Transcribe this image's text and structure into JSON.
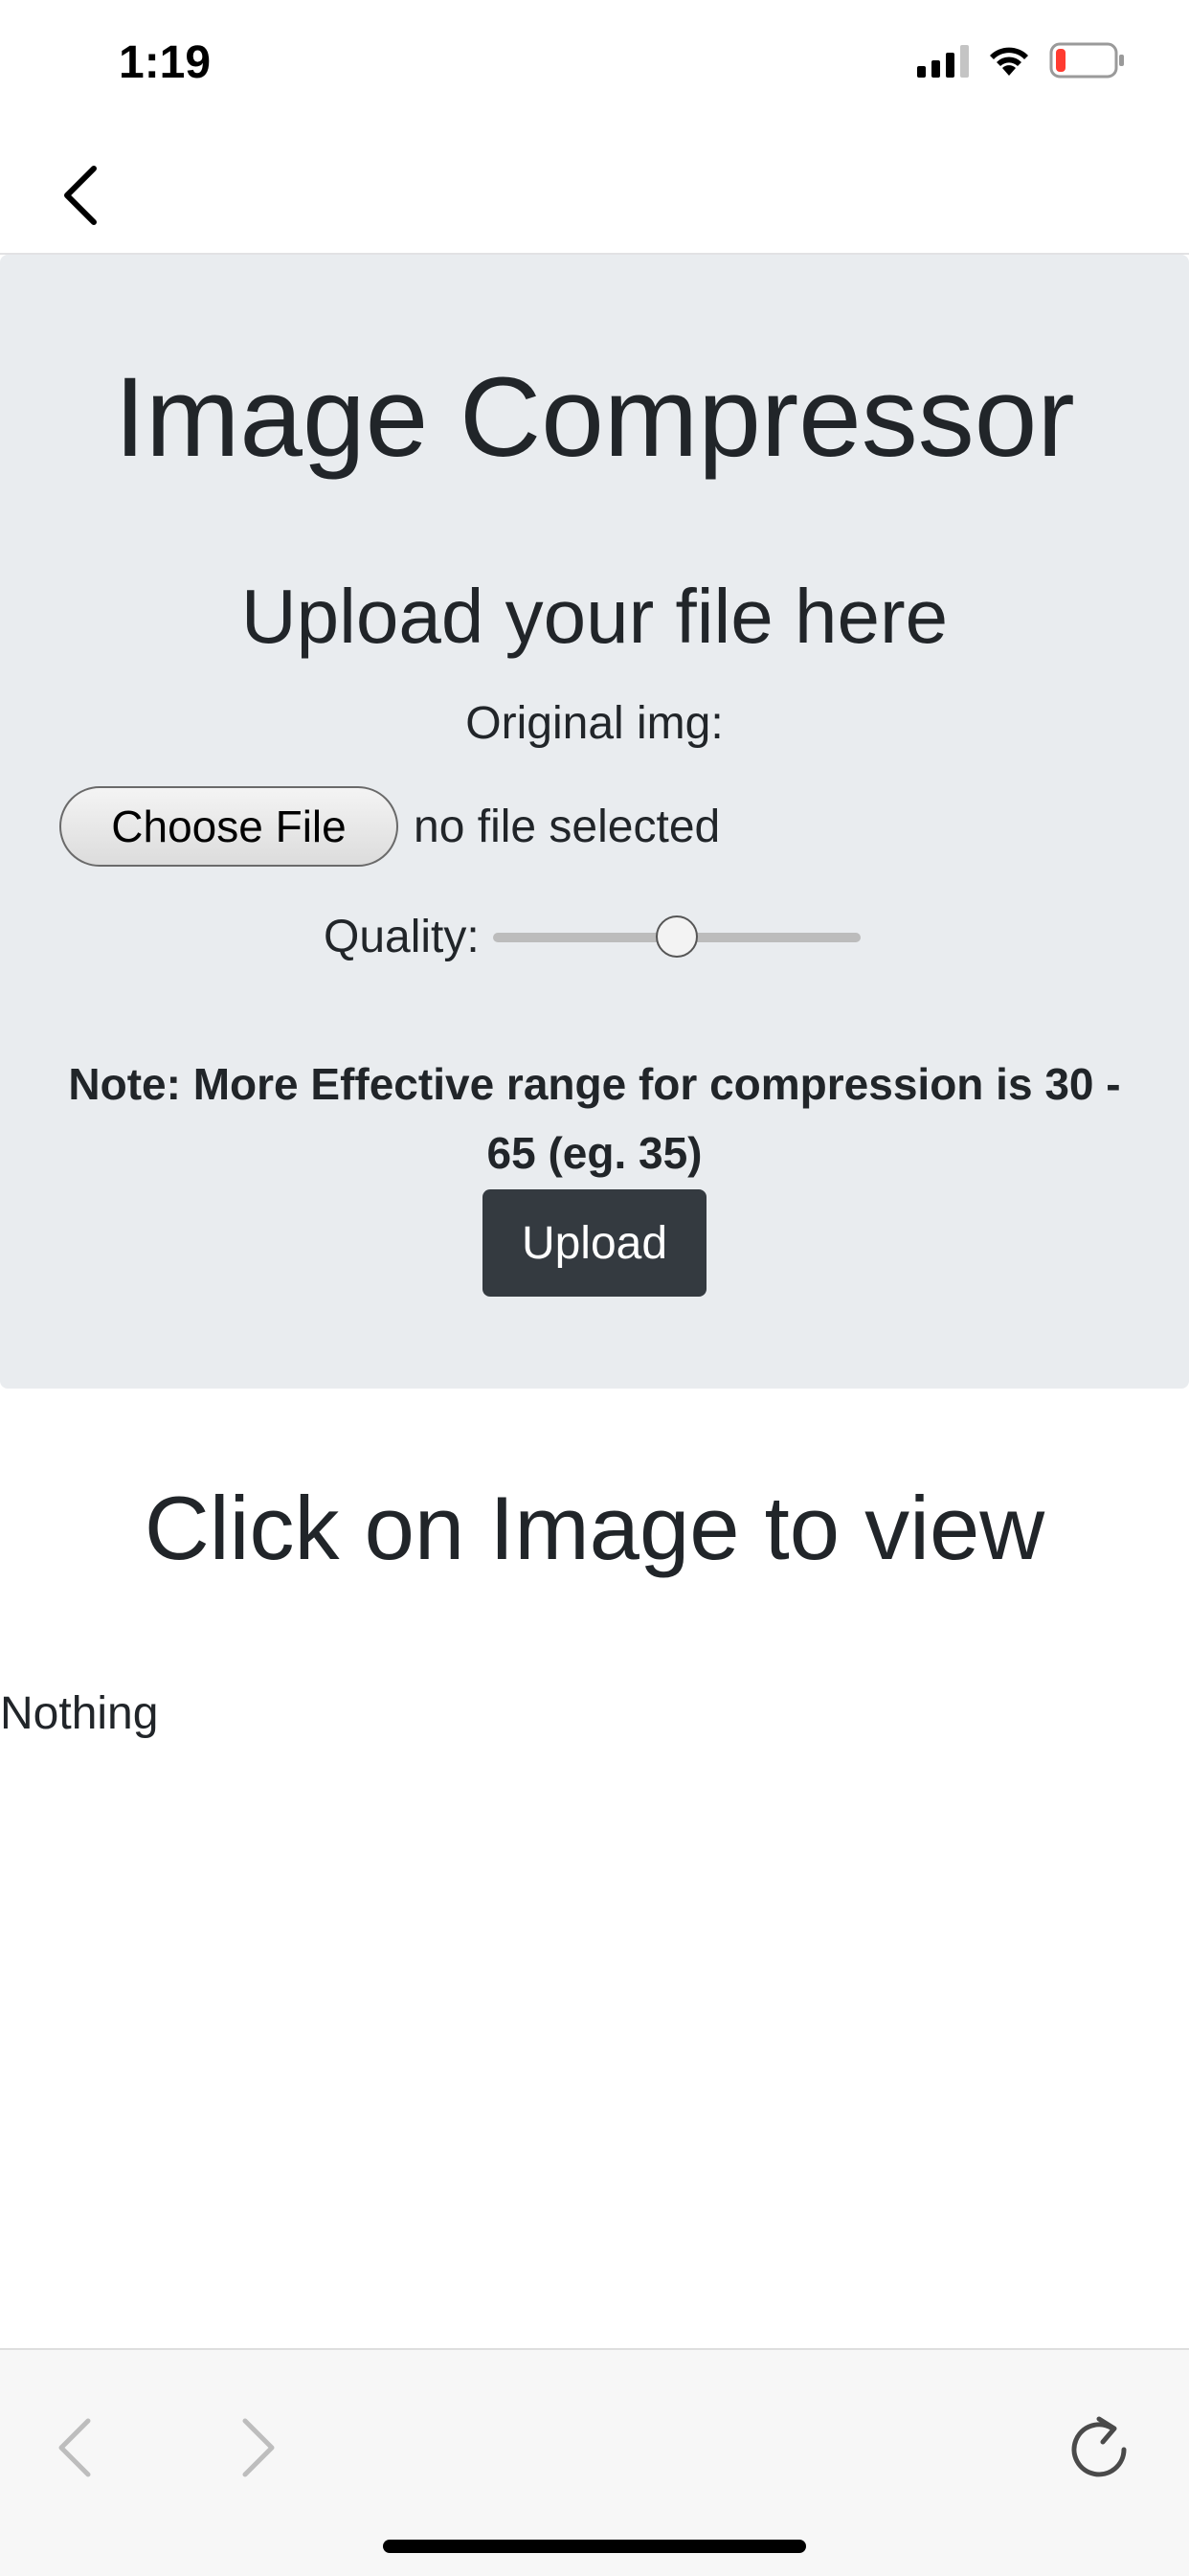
{
  "status_bar": {
    "time": "1:19",
    "battery_color": "#ff3b30"
  },
  "nav": {
    "back_icon": "chevron-left-icon"
  },
  "app": {
    "title": "Image Compressor",
    "upload_heading": "Upload your file here",
    "original_label": "Original img:",
    "choose_file_label": "Choose File",
    "file_status": "no file selected",
    "quality_label": "Quality:",
    "quality_value_fraction": 0.5,
    "note": "Note: More Effective range for compression is 30 - 65 (eg. 35)",
    "upload_label": "Upload"
  },
  "results": {
    "heading": "Click on Image to view",
    "empty_text": "Nothing"
  },
  "toolbar": {
    "back_icon": "chevron-left-icon",
    "forward_icon": "chevron-right-icon",
    "reload_icon": "reload-icon"
  },
  "colors": {
    "jumbotron_bg": "#e9ecef",
    "upload_button_bg": "#343a40",
    "text": "#212529"
  }
}
